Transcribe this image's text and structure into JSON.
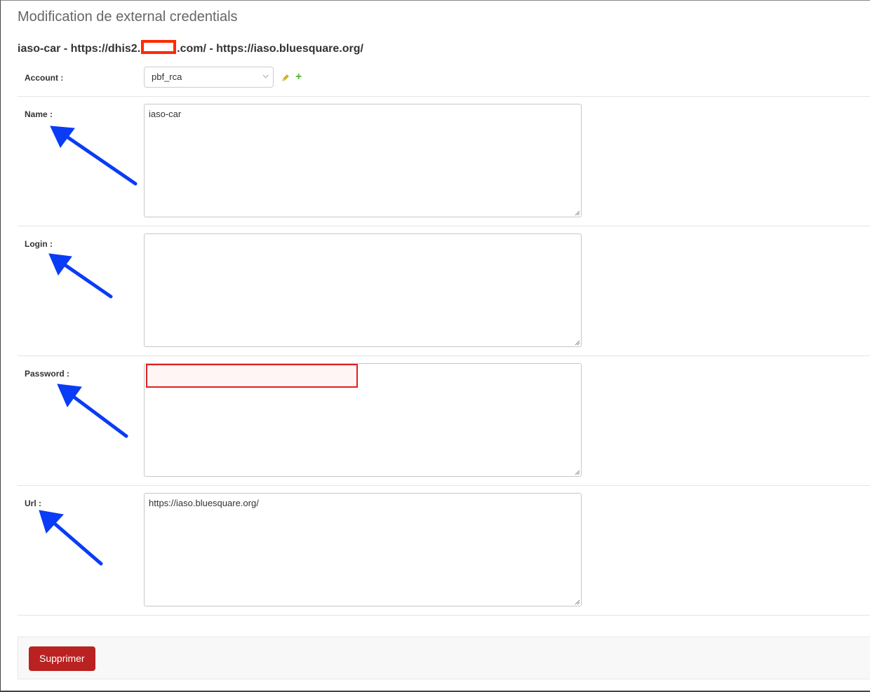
{
  "header": {
    "title": "Modification de external credentials",
    "subtitle_prefix": "iaso-car - https://dhis2.",
    "subtitle_suffix": ".com/ - https://iaso.bluesquare.org/"
  },
  "form": {
    "account": {
      "label": "Account :",
      "value": "pbf_rca",
      "edit_icon": "pencil-icon",
      "add_icon": "plus-icon"
    },
    "name": {
      "label": "Name :",
      "value": "iaso-car"
    },
    "login": {
      "label": "Login :",
      "value": ""
    },
    "password": {
      "label": "Password :",
      "value": ""
    },
    "url": {
      "label": "Url :",
      "value": "https://iaso.bluesquare.org/"
    }
  },
  "actions": {
    "delete_label": "Supprimer"
  },
  "colors": {
    "delete_button": "#ba2121",
    "annotation_arrow": "#0a3cf5",
    "redaction_box": "#ff2a00",
    "error_box": "#e02020",
    "add_icon": "#5ab335"
  }
}
